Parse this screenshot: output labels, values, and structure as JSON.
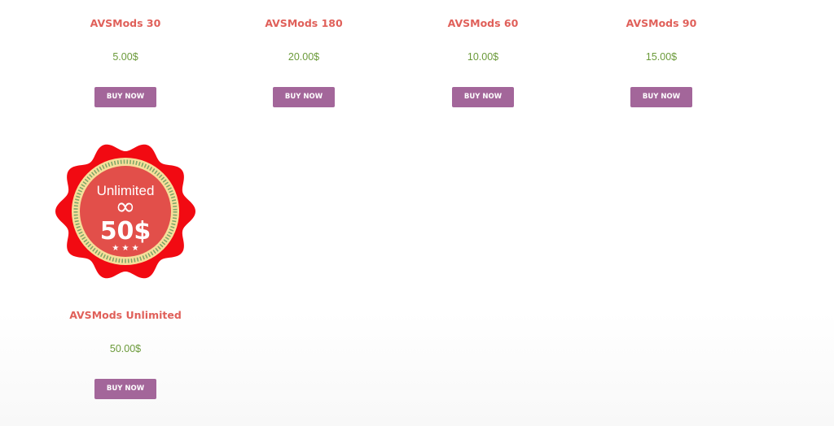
{
  "products": [
    {
      "title": "AVSMods 30",
      "price": "5.00$",
      "button_label": "BUY NOW"
    },
    {
      "title": "AVSMods 180",
      "price": "20.00$",
      "button_label": "BUY NOW"
    },
    {
      "title": "AVSMods 60",
      "price": "10.00$",
      "button_label": "BUY NOW"
    },
    {
      "title": "AVSMods 90",
      "price": "15.00$",
      "button_label": "BUY NOW"
    },
    {
      "title": "AVSMods Unlimited",
      "price": "50.00$",
      "button_label": "BUY NOW"
    }
  ],
  "badge": {
    "text_top": "Unlimited",
    "symbol": "∞",
    "amount": "50$",
    "stars": "★ ★ ★",
    "icon": "unlimited-badge-icon"
  },
  "colors": {
    "title": "#e0605a",
    "price": "#6b9a3a",
    "button": "#a3669a",
    "badge_outer": "#f20a12",
    "badge_ring": "#f6df9a",
    "badge_inner": "#e24f4a"
  }
}
